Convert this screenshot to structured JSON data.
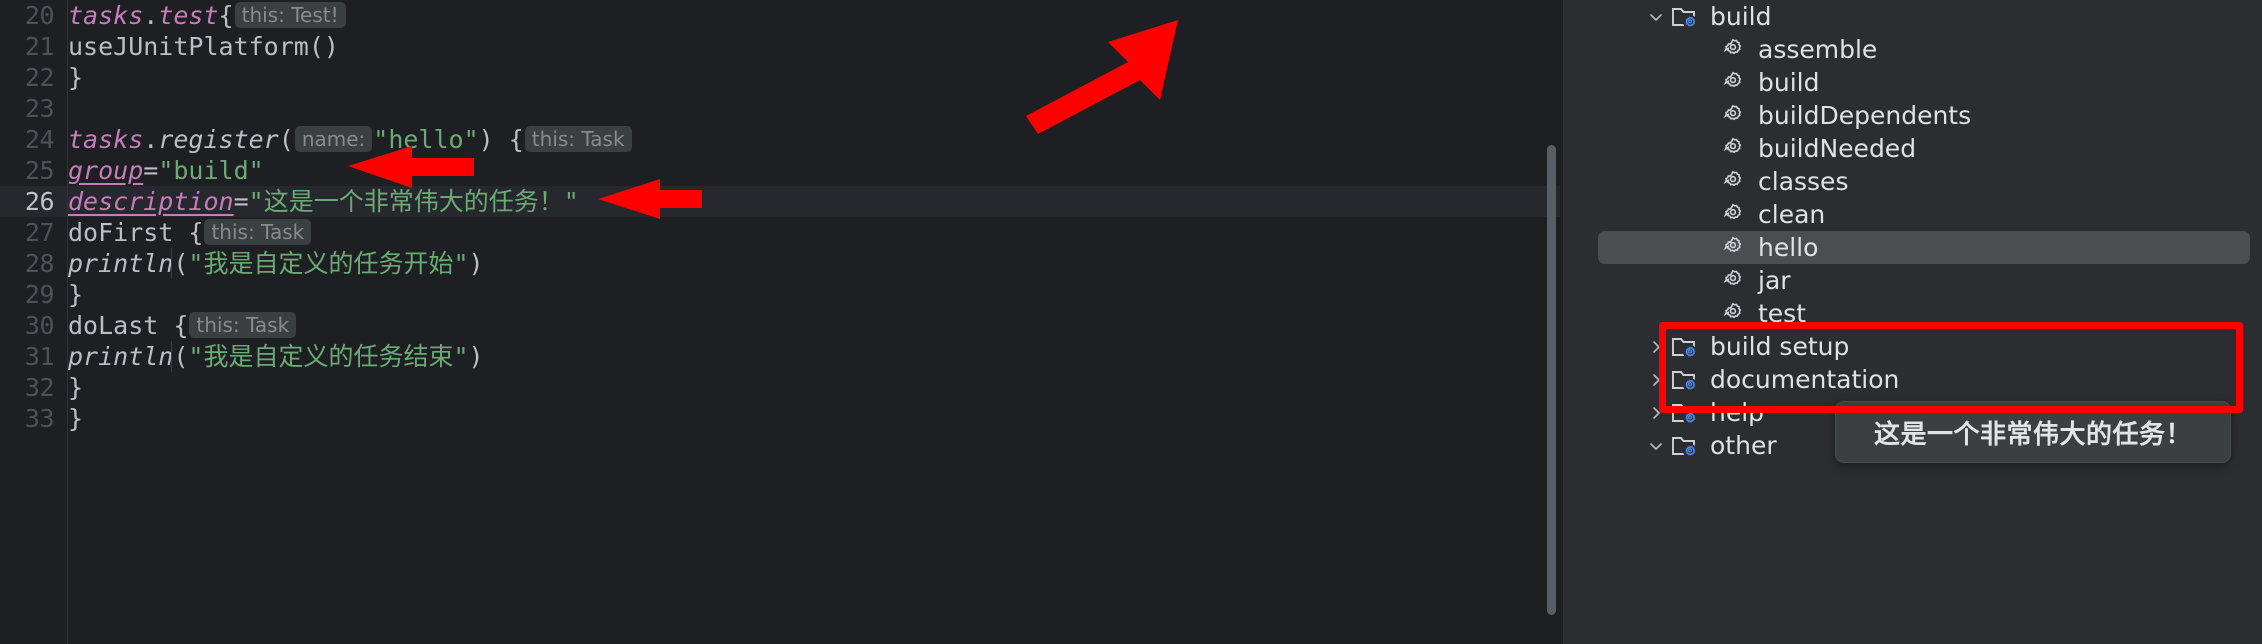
{
  "editor": {
    "line_numbers": [
      "20",
      "21",
      "22",
      "23",
      "24",
      "25",
      "26",
      "27",
      "28",
      "29",
      "30",
      "31",
      "32",
      "33"
    ],
    "current_line": "26",
    "lines": [
      {
        "n": "20",
        "indent": 0,
        "parts": [
          {
            "t": "kw-obj",
            "v": "tasks"
          },
          {
            "t": "plain",
            "v": "."
          },
          {
            "t": "kw-obj",
            "v": "test"
          },
          {
            "t": "plain",
            "v": " {"
          },
          {
            "t": "hint",
            "v": "this: Test!"
          }
        ]
      },
      {
        "n": "21",
        "indent": 0,
        "parts": [
          {
            "t": "plain",
            "v": "    useJUnitPlatform()"
          }
        ]
      },
      {
        "n": "22",
        "indent": 0,
        "parts": [
          {
            "t": "plain",
            "v": "}"
          }
        ]
      },
      {
        "n": "23",
        "indent": 0,
        "parts": []
      },
      {
        "n": "24",
        "indent": 0,
        "parts": [
          {
            "t": "kw-obj",
            "v": "tasks"
          },
          {
            "t": "plain",
            "v": "."
          },
          {
            "t": "fn-it",
            "v": "register"
          },
          {
            "t": "plain",
            "v": "("
          },
          {
            "t": "hint",
            "v": "name:"
          },
          {
            "t": "str",
            "v": "\"hello\""
          },
          {
            "t": "plain",
            "v": ") {"
          },
          {
            "t": "hint",
            "v": "this: Task"
          }
        ]
      },
      {
        "n": "25",
        "indent": 0,
        "parts": [
          {
            "t": "plain",
            "v": "    "
          },
          {
            "t": "prop",
            "v": "group"
          },
          {
            "t": "op",
            "v": " = "
          },
          {
            "t": "str",
            "v": "\"build\""
          }
        ]
      },
      {
        "n": "26",
        "indent": 0,
        "parts": [
          {
            "t": "plain",
            "v": "    "
          },
          {
            "t": "prop",
            "v": "description"
          },
          {
            "t": "op",
            "v": " = "
          },
          {
            "t": "str",
            "v": "\"这是一个非常伟大的任务！\""
          }
        ]
      },
      {
        "n": "27",
        "indent": 0,
        "parts": [
          {
            "t": "plain",
            "v": "    doFirst {"
          },
          {
            "t": "hint",
            "v": "this: Task"
          }
        ]
      },
      {
        "n": "28",
        "indent": 0,
        "parts": [
          {
            "t": "plain",
            "v": "        "
          },
          {
            "t": "fn-it",
            "v": "println"
          },
          {
            "t": "plain",
            "v": "("
          },
          {
            "t": "str",
            "v": "\"我是自定义的任务开始\""
          },
          {
            "t": "plain",
            "v": ")"
          }
        ]
      },
      {
        "n": "29",
        "indent": 0,
        "parts": [
          {
            "t": "plain",
            "v": "    }"
          }
        ]
      },
      {
        "n": "30",
        "indent": 0,
        "parts": [
          {
            "t": "plain",
            "v": "    doLast {"
          },
          {
            "t": "hint",
            "v": "this: Task"
          }
        ]
      },
      {
        "n": "31",
        "indent": 0,
        "parts": [
          {
            "t": "plain",
            "v": "        "
          },
          {
            "t": "fn-it",
            "v": "println"
          },
          {
            "t": "plain",
            "v": "("
          },
          {
            "t": "str",
            "v": "\"我是自定义的任务结束\""
          },
          {
            "t": "plain",
            "v": ")"
          }
        ]
      },
      {
        "n": "32",
        "indent": 0,
        "parts": [
          {
            "t": "plain",
            "v": "    }"
          }
        ]
      },
      {
        "n": "33",
        "indent": 0,
        "parts": [
          {
            "t": "plain",
            "v": "}"
          }
        ]
      }
    ]
  },
  "tree": {
    "rows": [
      {
        "label": "build",
        "icon": "folder-gear-icon",
        "chevron": "down",
        "depth": 0,
        "selected": false
      },
      {
        "label": "assemble",
        "icon": "gear-icon",
        "chevron": "none",
        "depth": 1,
        "selected": false
      },
      {
        "label": "build",
        "icon": "gear-icon",
        "chevron": "none",
        "depth": 1,
        "selected": false
      },
      {
        "label": "buildDependents",
        "icon": "gear-icon",
        "chevron": "none",
        "depth": 1,
        "selected": false
      },
      {
        "label": "buildNeeded",
        "icon": "gear-icon",
        "chevron": "none",
        "depth": 1,
        "selected": false
      },
      {
        "label": "classes",
        "icon": "gear-icon",
        "chevron": "none",
        "depth": 1,
        "selected": false
      },
      {
        "label": "clean",
        "icon": "gear-icon",
        "chevron": "none",
        "depth": 1,
        "selected": false
      },
      {
        "label": "hello",
        "icon": "gear-icon",
        "chevron": "none",
        "depth": 1,
        "selected": true
      },
      {
        "label": "jar",
        "icon": "gear-icon",
        "chevron": "none",
        "depth": 1,
        "selected": false
      },
      {
        "label": "test",
        "icon": "gear-icon",
        "chevron": "none",
        "depth": 1,
        "selected": false
      },
      {
        "label": "build setup",
        "icon": "folder-gear-icon",
        "chevron": "right",
        "depth": 0,
        "selected": false
      },
      {
        "label": "documentation",
        "icon": "folder-gear-icon",
        "chevron": "right",
        "depth": 0,
        "selected": false
      },
      {
        "label": "help",
        "icon": "folder-gear-icon",
        "chevron": "right",
        "depth": 0,
        "selected": false
      },
      {
        "label": "other",
        "icon": "folder-gear-icon",
        "chevron": "down",
        "depth": 0,
        "selected": false
      }
    ]
  },
  "tooltip": {
    "text": "这是一个非常伟大的任务！"
  },
  "colors": {
    "editor_bg": "#1E1F22",
    "panel_bg": "#2B2D30",
    "current_line_bg": "#26282E",
    "string_green": "#6AAB73",
    "identifier_pink": "#C77DBB",
    "annotation_red": "#FF0000",
    "selection_gray": "#4B4D51",
    "tooltip_bg": "#3C3F41"
  }
}
